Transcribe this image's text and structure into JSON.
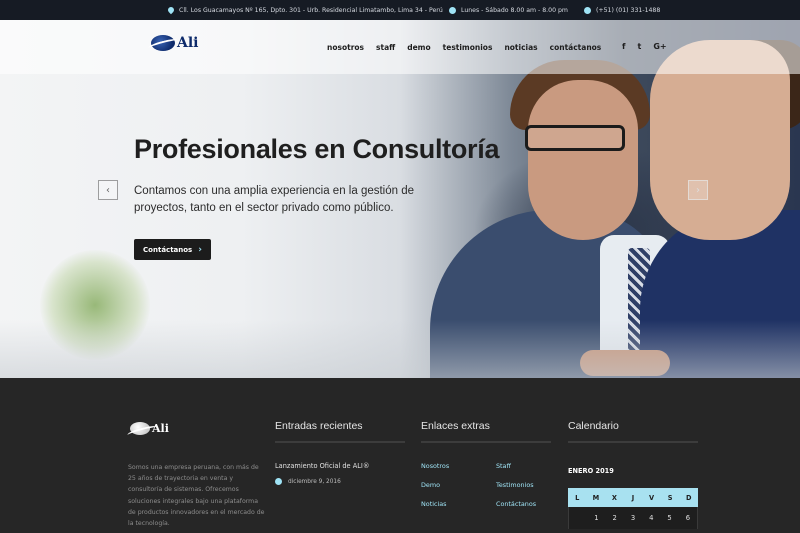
{
  "topbar": {
    "address": "Cll. Los Guacamayos Nº 165, Dpto. 301 - Urb. Residencial Limatambo, Lima 34 - Perú",
    "hours": "Lunes - Sábado 8.00 am - 8.00 pm",
    "phone": "(+51) (01) 331-1488"
  },
  "header": {
    "logo_text": "Ali",
    "nav": [
      "nosotros",
      "staff",
      "demo",
      "testimonios",
      "noticias",
      "contáctanos"
    ],
    "social": [
      "f",
      "t",
      "G+"
    ]
  },
  "hero": {
    "title": "Profesionales en Consultoría",
    "subtitle": "Contamos con una amplia experiencia en la gestión de proyectos, tanto en el sector privado como público.",
    "cta_label": "Contáctanos",
    "prev_arrow": "‹",
    "next_arrow": "›"
  },
  "footer": {
    "logo_text": "Ali",
    "about": "Somos una empresa peruana, con más de 25 años de trayectoria en venta y consultoría de sistemas. Ofrecemos soluciones integrales bajo una plataforma de productos innovadores en el mercado de la tecnología.",
    "recent": {
      "heading": "Entradas recientes",
      "post_title": "Lanzamiento Oficial de ALI®",
      "post_date": "diciembre 9, 2016"
    },
    "links": {
      "heading": "Enlaces extras",
      "col1": [
        "Nosotros",
        "Demo",
        "Noticias"
      ],
      "col2": [
        "Staff",
        "Testimonios",
        "Contáctanos"
      ]
    },
    "calendar": {
      "heading": "Calendario",
      "month": "ENERO 2019",
      "days": [
        "L",
        "M",
        "X",
        "J",
        "V",
        "S",
        "D"
      ],
      "first_row": [
        "",
        "1",
        "2",
        "3",
        "4",
        "5",
        "6"
      ]
    }
  },
  "colors": {
    "accent": "#9fe3f5",
    "footer_bg": "#262626",
    "topbar_bg": "#161b24",
    "brand": "#0d2a6a"
  }
}
